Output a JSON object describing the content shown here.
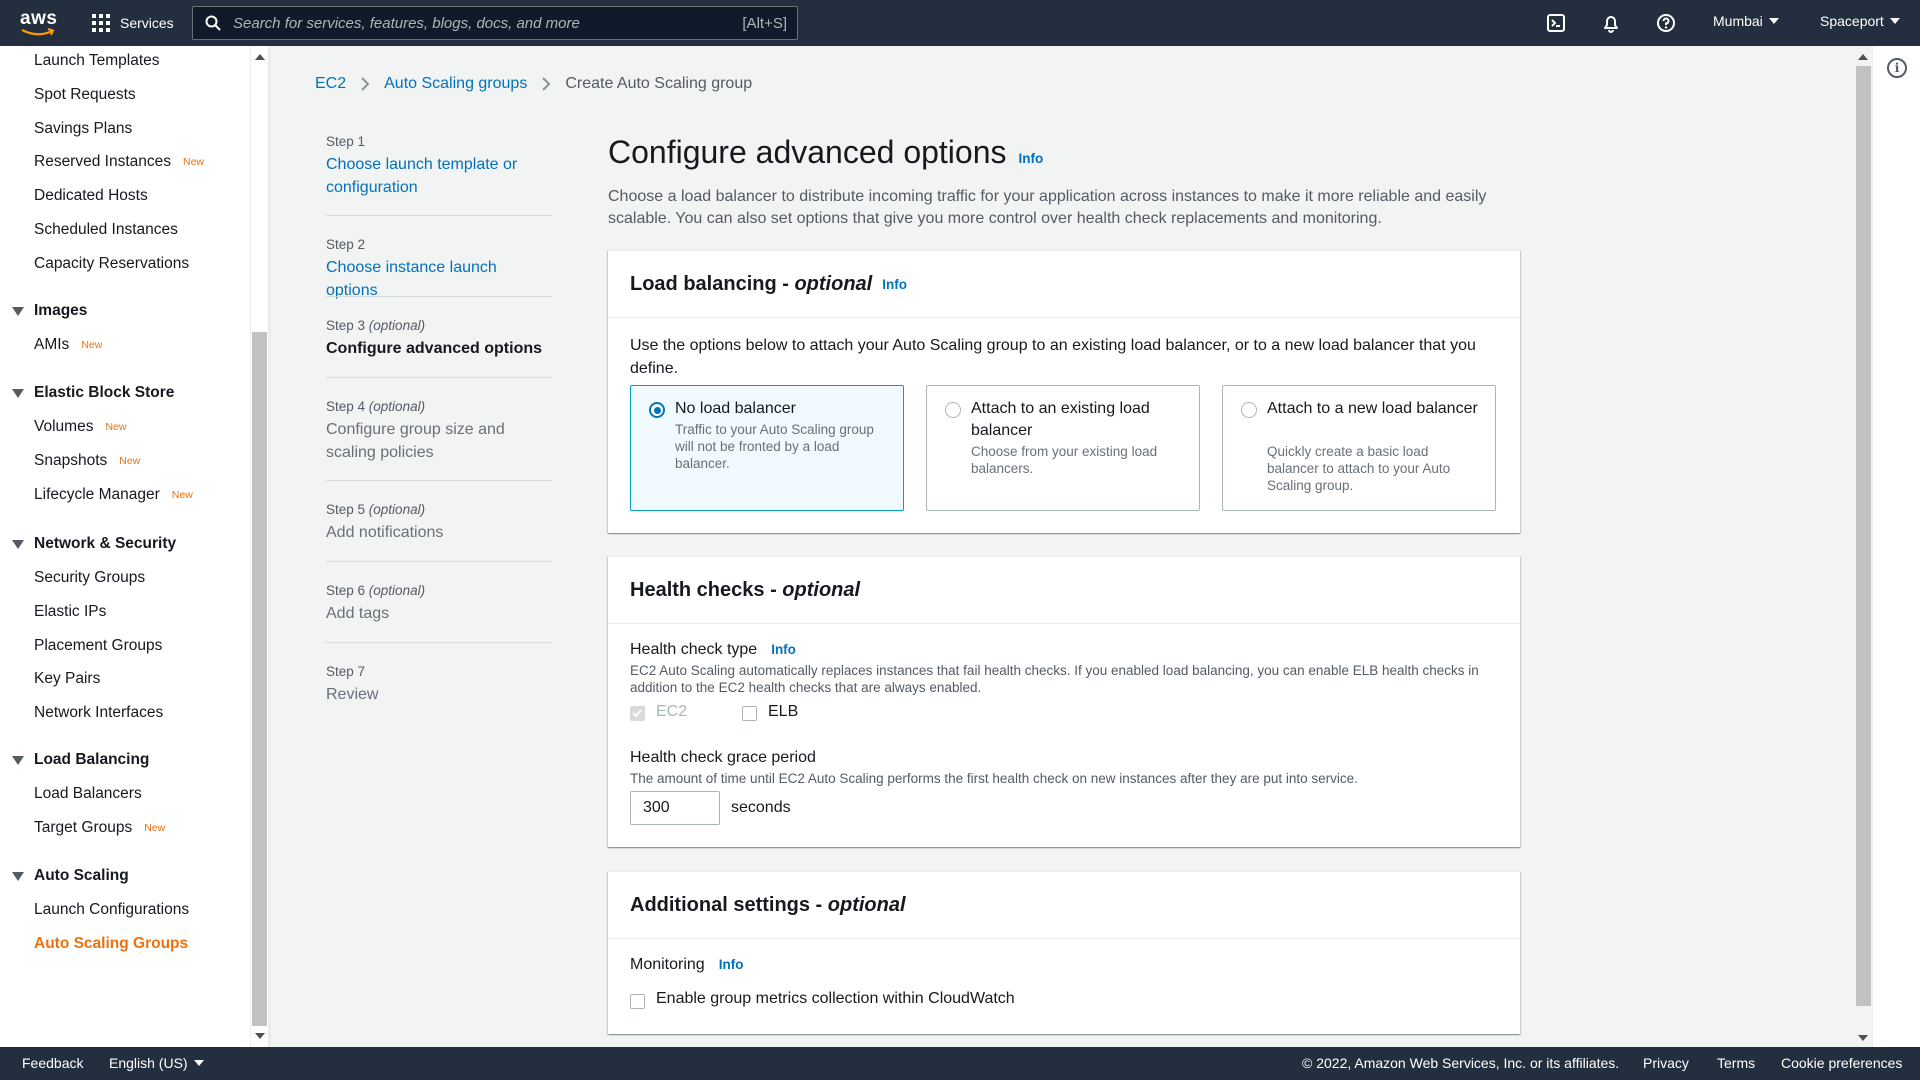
{
  "topnav": {
    "logo_text": "aws",
    "services_label": "Services",
    "search_placeholder": "Search for services, features, blogs, docs, and more",
    "search_shortcut": "[Alt+S]",
    "region": "Mumbai",
    "account": "Spaceport"
  },
  "sidebar": {
    "items_top": [
      {
        "label": "Launch Templates",
        "badge": ""
      },
      {
        "label": "Spot Requests",
        "badge": ""
      },
      {
        "label": "Savings Plans",
        "badge": ""
      },
      {
        "label": "Reserved Instances",
        "badge": "New"
      },
      {
        "label": "Dedicated Hosts",
        "badge": ""
      },
      {
        "label": "Scheduled Instances",
        "badge": ""
      },
      {
        "label": "Capacity Reservations",
        "badge": ""
      }
    ],
    "images": {
      "title": "Images",
      "items": [
        {
          "label": "AMIs",
          "badge": "New"
        }
      ]
    },
    "ebs": {
      "title": "Elastic Block Store",
      "items": [
        {
          "label": "Volumes",
          "badge": "New"
        },
        {
          "label": "Snapshots",
          "badge": "New"
        },
        {
          "label": "Lifecycle Manager",
          "badge": "New"
        }
      ]
    },
    "network": {
      "title": "Network & Security",
      "items": [
        {
          "label": "Security Groups"
        },
        {
          "label": "Elastic IPs"
        },
        {
          "label": "Placement Groups"
        },
        {
          "label": "Key Pairs"
        },
        {
          "label": "Network Interfaces"
        }
      ]
    },
    "lb": {
      "title": "Load Balancing",
      "items": [
        {
          "label": "Load Balancers",
          "badge": ""
        },
        {
          "label": "Target Groups",
          "badge": "New"
        }
      ]
    },
    "asg": {
      "title": "Auto Scaling",
      "items": [
        {
          "label": "Launch Configurations"
        },
        {
          "label": "Auto Scaling Groups"
        }
      ]
    }
  },
  "breadcrumb": {
    "items": [
      "EC2",
      "Auto Scaling groups",
      "Create Auto Scaling group"
    ]
  },
  "steps": [
    {
      "label": "Step 1",
      "optional": "",
      "title": "Choose launch template or configuration"
    },
    {
      "label": "Step 2",
      "optional": "",
      "title": "Choose instance launch options"
    },
    {
      "label": "Step 3",
      "optional": "(optional)",
      "title": "Configure advanced options"
    },
    {
      "label": "Step 4",
      "optional": "(optional)",
      "title": "Configure group size and scaling policies"
    },
    {
      "label": "Step 5",
      "optional": "(optional)",
      "title": "Add notifications"
    },
    {
      "label": "Step 6",
      "optional": "(optional)",
      "title": "Add tags"
    },
    {
      "label": "Step 7",
      "optional": "",
      "title": "Review"
    }
  ],
  "main": {
    "title": "Configure advanced options",
    "info": "Info",
    "description": "Choose a load balancer to distribute incoming traffic for your application across instances to make it more reliable and easily scalable. You can also set options that give you more control over health check replacements and monitoring."
  },
  "load_balancing": {
    "title": "Load balancing - ",
    "title_opt": "optional",
    "info": "Info",
    "description": "Use the options below to attach your Auto Scaling group to an existing load balancer, or to a new load balancer that you define.",
    "options": [
      {
        "title": "No load balancer",
        "desc": "Traffic to your Auto Scaling group will not be fronted by a load balancer."
      },
      {
        "title": "Attach to an existing load balancer",
        "desc": "Choose from your existing load balancers."
      },
      {
        "title": "Attach to a new load balancer",
        "desc": "Quickly create a basic load balancer to attach to your Auto Scaling group."
      }
    ],
    "selected_index": 0
  },
  "health_checks": {
    "title": "Health checks - ",
    "title_opt": "optional",
    "type_label": "Health check type",
    "info": "Info",
    "type_desc": "EC2 Auto Scaling automatically replaces instances that fail health checks. If you enabled load balancing, you can enable ELB health checks in addition to the EC2 health checks that are always enabled.",
    "ec2_label": "EC2",
    "elb_label": "ELB",
    "grace_label": "Health check grace period",
    "grace_desc": "The amount of time until EC2 Auto Scaling performs the first health check on new instances after they are put into service.",
    "grace_value": "300",
    "grace_unit": "seconds"
  },
  "additional": {
    "title": "Additional settings - ",
    "title_opt": "optional",
    "monitoring_label": "Monitoring",
    "info": "Info",
    "metrics_label": "Enable group metrics collection within CloudWatch"
  },
  "footer": {
    "feedback": "Feedback",
    "language": "English (US)",
    "copyright": "© 2022, Amazon Web Services, Inc. or its affiliates.",
    "privacy": "Privacy",
    "terms": "Terms",
    "cookies": "Cookie preferences"
  },
  "colors": {
    "nav_bg": "#232f3e",
    "link": "#0073bb",
    "active_orange": "#ec7211",
    "selected_border": "#00a1c9"
  }
}
